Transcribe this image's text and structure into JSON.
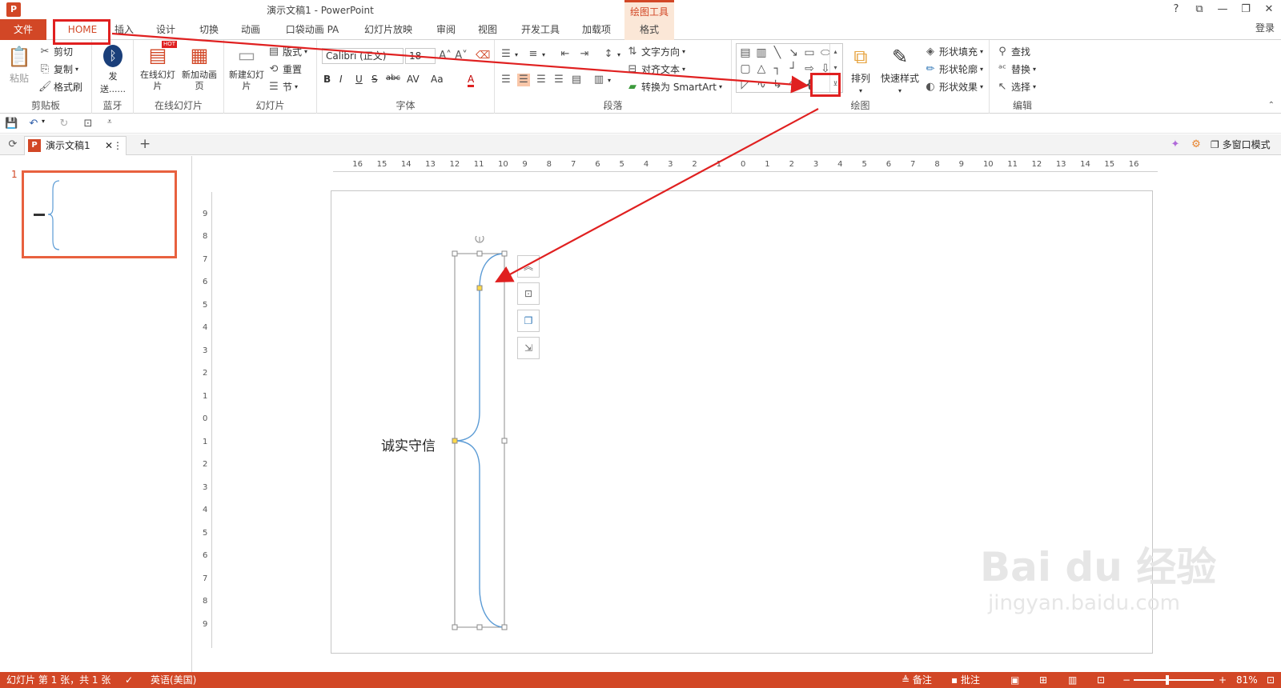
{
  "window": {
    "title": "演示文稿1 - PowerPoint",
    "contextual_group": "绘图工具",
    "controls": [
      "?",
      "⧉",
      "—",
      "❐",
      "✕"
    ]
  },
  "tabs": {
    "file": "文件",
    "items": [
      "HOME",
      "插入",
      "设计",
      "切换",
      "动画",
      "口袋动画 PA",
      "幻灯片放映",
      "审阅",
      "视图",
      "开发工具",
      "加载项"
    ],
    "format": "格式",
    "login": "登录"
  },
  "ribbon": {
    "clipboard": {
      "paste": "粘贴",
      "cut": "剪切",
      "copy": "复制",
      "format_painter": "格式刷",
      "label": "剪贴板"
    },
    "bluetooth": {
      "send": "发送......",
      "label": "蓝牙"
    },
    "online_slides": {
      "online": "在线幻灯片",
      "new_page": "新加动画页",
      "hot": "HOT",
      "label": "在线幻灯片"
    },
    "slides": {
      "new_slide": "新建幻灯片",
      "layout": "版式",
      "reset": "重置",
      "section": "节",
      "label": "幻灯片"
    },
    "font": {
      "name": "Calibri (正文)",
      "size": "18",
      "label": "字体",
      "buttons": [
        "B",
        "I",
        "U",
        "S",
        "abc",
        "AV",
        "Aa",
        "A"
      ]
    },
    "paragraph": {
      "text_direction": "文字方向",
      "align_text": "对齐文本",
      "smartart": "转换为 SmartArt",
      "label": "段落"
    },
    "drawing": {
      "arrange": "排列",
      "quick_styles": "快速样式",
      "fill": "形状填充",
      "outline": "形状轮廓",
      "effects": "形状效果",
      "label": "绘图",
      "brace_shape": "{"
    },
    "editing": {
      "find": "查找",
      "replace": "替换",
      "select": "选择",
      "label": "编辑"
    }
  },
  "doc_tab": {
    "name": "演示文稿1",
    "multi_window": "多窗口模式"
  },
  "thumbnail": {
    "number": "1"
  },
  "ruler": {
    "h_ticks": [
      "16",
      "15",
      "14",
      "13",
      "12",
      "11",
      "10",
      "9",
      "8",
      "7",
      "6",
      "5",
      "4",
      "3",
      "2",
      "1",
      "0",
      "1",
      "2",
      "3",
      "4",
      "5",
      "6",
      "7",
      "8",
      "9",
      "10",
      "11",
      "12",
      "13",
      "14",
      "15",
      "16"
    ],
    "v_ticks": [
      "9",
      "8",
      "7",
      "6",
      "5",
      "4",
      "3",
      "2",
      "1",
      "0",
      "1",
      "2",
      "3",
      "4",
      "5",
      "6",
      "7",
      "8",
      "9"
    ]
  },
  "slide": {
    "text": "诚实守信"
  },
  "watermark": {
    "brand": "Bai du 经验",
    "url": "jingyan.baidu.com"
  },
  "status": {
    "slide_info": "幻灯片 第 1 张，共 1 张",
    "language": "英语(美国)",
    "notes": "备注",
    "comments": "批注",
    "zoom": "81%"
  },
  "colors": {
    "accent": "#d24726",
    "annotation": "#e02020",
    "shape_line": "#5b9bd5"
  }
}
